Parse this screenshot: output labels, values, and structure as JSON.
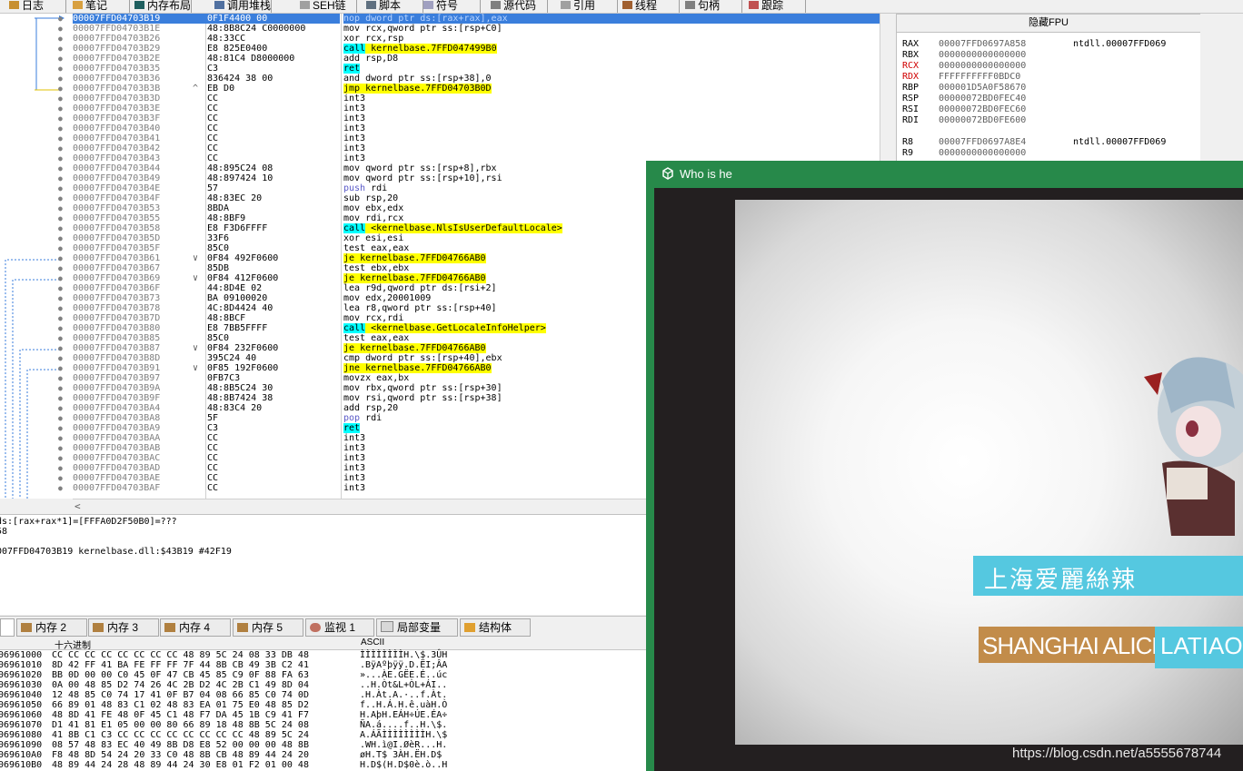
{
  "toolbar_tabs": [
    {
      "label": "日志",
      "icon": "log-icon"
    },
    {
      "label": "笔记",
      "icon": "notes-icon"
    },
    {
      "label": "内存布局",
      "icon": "memory-map-icon"
    },
    {
      "label": "调用堆栈",
      "icon": "call-stack-icon"
    },
    {
      "label": "SEH链",
      "icon": "seh-icon"
    },
    {
      "label": "脚本",
      "icon": "script-icon"
    },
    {
      "label": "符号",
      "icon": "symbols-icon"
    },
    {
      "label": "源代码",
      "icon": "source-icon"
    },
    {
      "label": "引用",
      "icon": "references-icon"
    },
    {
      "label": "线程",
      "icon": "threads-icon"
    },
    {
      "label": "句柄",
      "icon": "handles-icon"
    },
    {
      "label": "跟踪",
      "icon": "trace-icon"
    }
  ],
  "disasm": [
    {
      "addr": "00007FFD04703B19",
      "bytes": "0F1F4400 00",
      "ins": "nop dword ptr ds:[rax+rax],eax",
      "selected": true
    },
    {
      "addr": "00007FFD04703B1E",
      "bytes": "48:8B8C24 C0000000",
      "ins": "mov rcx,qword ptr ss:[rsp+C0]"
    },
    {
      "addr": "00007FFD04703B26",
      "bytes": "48:33CC",
      "ins": "xor rcx,rsp"
    },
    {
      "addr": "00007FFD04703B29",
      "bytes": "E8 825E0400",
      "ins": "call kernelbase.7FFD047499B0",
      "hl": "call"
    },
    {
      "addr": "00007FFD04703B2E",
      "bytes": "48:81C4 D8000000",
      "ins": "add rsp,D8"
    },
    {
      "addr": "00007FFD04703B35",
      "bytes": "C3",
      "ins": "ret",
      "hl": "ret"
    },
    {
      "addr": "00007FFD04703B36",
      "bytes": "836424 38 00",
      "ins": "and dword ptr ss:[rsp+38],0"
    },
    {
      "addr": "00007FFD04703B3B",
      "bytes": "EB D0",
      "ins": "jmp kernelbase.7FFD04703B0D",
      "hl": "jmp",
      "arrow": "^"
    },
    {
      "addr": "00007FFD04703B3D",
      "bytes": "CC",
      "ins": "int3"
    },
    {
      "addr": "00007FFD04703B3E",
      "bytes": "CC",
      "ins": "int3"
    },
    {
      "addr": "00007FFD04703B3F",
      "bytes": "CC",
      "ins": "int3"
    },
    {
      "addr": "00007FFD04703B40",
      "bytes": "CC",
      "ins": "int3"
    },
    {
      "addr": "00007FFD04703B41",
      "bytes": "CC",
      "ins": "int3"
    },
    {
      "addr": "00007FFD04703B42",
      "bytes": "CC",
      "ins": "int3"
    },
    {
      "addr": "00007FFD04703B43",
      "bytes": "CC",
      "ins": "int3"
    },
    {
      "addr": "00007FFD04703B44",
      "bytes": "48:895C24 08",
      "ins": "mov qword ptr ss:[rsp+8],rbx"
    },
    {
      "addr": "00007FFD04703B49",
      "bytes": "48:897424 10",
      "ins": "mov qword ptr ss:[rsp+10],rsi"
    },
    {
      "addr": "00007FFD04703B4E",
      "bytes": "57",
      "ins": "push rdi",
      "style": "blue"
    },
    {
      "addr": "00007FFD04703B4F",
      "bytes": "48:83EC 20",
      "ins": "sub rsp,20"
    },
    {
      "addr": "00007FFD04703B53",
      "bytes": "8BDA",
      "ins": "mov ebx,edx"
    },
    {
      "addr": "00007FFD04703B55",
      "bytes": "48:8BF9",
      "ins": "mov rdi,rcx"
    },
    {
      "addr": "00007FFD04703B58",
      "bytes": "E8 F3D6FFFF",
      "ins": "call <kernelbase.NlsIsUserDefaultLocale>",
      "hl": "call"
    },
    {
      "addr": "00007FFD04703B5D",
      "bytes": "33F6",
      "ins": "xor esi,esi"
    },
    {
      "addr": "00007FFD04703B5F",
      "bytes": "85C0",
      "ins": "test eax,eax"
    },
    {
      "addr": "00007FFD04703B61",
      "bytes": "0F84 492F0600",
      "ins": "je kernelbase.7FFD04766AB0",
      "hl": "jcc",
      "arrow": "v"
    },
    {
      "addr": "00007FFD04703B67",
      "bytes": "85DB",
      "ins": "test ebx,ebx"
    },
    {
      "addr": "00007FFD04703B69",
      "bytes": "0F84 412F0600",
      "ins": "je kernelbase.7FFD04766AB0",
      "hl": "jcc",
      "arrow": "v"
    },
    {
      "addr": "00007FFD04703B6F",
      "bytes": "44:8D4E 02",
      "ins": "lea r9d,qword ptr ds:[rsi+2]"
    },
    {
      "addr": "00007FFD04703B73",
      "bytes": "BA 09100020",
      "ins": "mov edx,20001009"
    },
    {
      "addr": "00007FFD04703B78",
      "bytes": "4C:8D4424 40",
      "ins": "lea r8,qword ptr ss:[rsp+40]"
    },
    {
      "addr": "00007FFD04703B7D",
      "bytes": "48:8BCF",
      "ins": "mov rcx,rdi"
    },
    {
      "addr": "00007FFD04703B80",
      "bytes": "E8 7BB5FFFF",
      "ins": "call <kernelbase.GetLocaleInfoHelper>",
      "hl": "call"
    },
    {
      "addr": "00007FFD04703B85",
      "bytes": "85C0",
      "ins": "test eax,eax"
    },
    {
      "addr": "00007FFD04703B87",
      "bytes": "0F84 232F0600",
      "ins": "je kernelbase.7FFD04766AB0",
      "hl": "jcc",
      "arrow": "v"
    },
    {
      "addr": "00007FFD04703B8D",
      "bytes": "395C24 40",
      "ins": "cmp dword ptr ss:[rsp+40],ebx"
    },
    {
      "addr": "00007FFD04703B91",
      "bytes": "0F85 192F0600",
      "ins": "jne kernelbase.7FFD04766AB0",
      "hl": "jcc",
      "arrow": "v"
    },
    {
      "addr": "00007FFD04703B97",
      "bytes": "0FB7C3",
      "ins": "movzx eax,bx"
    },
    {
      "addr": "00007FFD04703B9A",
      "bytes": "48:8B5C24 30",
      "ins": "mov rbx,qword ptr ss:[rsp+30]"
    },
    {
      "addr": "00007FFD04703B9F",
      "bytes": "48:8B7424 38",
      "ins": "mov rsi,qword ptr ss:[rsp+38]"
    },
    {
      "addr": "00007FFD04703BA4",
      "bytes": "48:83C4 20",
      "ins": "add rsp,20"
    },
    {
      "addr": "00007FFD04703BA8",
      "bytes": "5F",
      "ins": "pop rdi",
      "style": "blue"
    },
    {
      "addr": "00007FFD04703BA9",
      "bytes": "C3",
      "ins": "ret",
      "hl": "ret"
    },
    {
      "addr": "00007FFD04703BAA",
      "bytes": "CC",
      "ins": "int3"
    },
    {
      "addr": "00007FFD04703BAB",
      "bytes": "CC",
      "ins": "int3"
    },
    {
      "addr": "00007FFD04703BAC",
      "bytes": "CC",
      "ins": "int3"
    },
    {
      "addr": "00007FFD04703BAD",
      "bytes": "CC",
      "ins": "int3"
    },
    {
      "addr": "00007FFD04703BAE",
      "bytes": "CC",
      "ins": "int3"
    },
    {
      "addr": "00007FFD04703BAF",
      "bytes": "CC",
      "ins": "int3"
    }
  ],
  "info_lines": [
    "ds:[rax+rax*1]=[FFFA0D2F50B0]=???",
    "58",
    "",
    "007FFD04703B19 kernelbase.dll:$43B19 #42F19"
  ],
  "bottom_tabs": [
    "内存 2",
    "内存 3",
    "内存 4",
    "内存 5",
    "监视 1",
    "局部变量",
    "结构体"
  ],
  "hex": {
    "header_bytes": "十六进制",
    "header_ascii": "ASCII",
    "rows": [
      {
        "addr": "06961000",
        "bytes": "CC CC CC CC CC CC CC CC 48 89 5C 24 08 33 DB 48",
        "ascii": "ÌÌÌÌÌÌÌÌH.\\$.3ÛH"
      },
      {
        "addr": "06961010",
        "bytes": "8D 42 FF 41 BA FE FF FF 7F 44 8B CB 49 3B C2 41",
        "ascii": ".BÿAºþÿÿ.D.ËI;ÂA"
      },
      {
        "addr": "06961020",
        "bytes": "BB 0D 00 00 C0 45 0F 47 CB 45 85 C9 0F 88 FA 63",
        "ascii": "»...ÀE.GËE.É..úc"
      },
      {
        "addr": "06961030",
        "bytes": "0A 00 48 85 D2 74 26 4C 2B D2 4C 2B C1 49 8D 04",
        "ascii": "..H.Òt&L+ÒL+ÁI.."
      },
      {
        "addr": "06961040",
        "bytes": "12 48 85 C0 74 17 41 0F B7 04 08 66 85 C0 74 0D",
        "ascii": ".H.Àt.A.·..f.Àt."
      },
      {
        "addr": "06961050",
        "bytes": "66 89 01 48 83 C1 02 48 83 EA 01 75 E0 48 85 D2",
        "ascii": "f..H.Á.H.ê.uàH.Ò"
      },
      {
        "addr": "06961060",
        "bytes": "48 8D 41 FE 48 0F 45 C1 48 F7 DA 45 1B C9 41 F7",
        "ascii": "H.AþH.EÁH÷ÚE.ÉA÷"
      },
      {
        "addr": "06961070",
        "bytes": "D1 41 81 E1 05 00 00 80 66 89 18 48 8B 5C 24 08",
        "ascii": "ÑA.á....f..H.\\$."
      },
      {
        "addr": "06961080",
        "bytes": "41 8B C1 C3 CC CC CC CC CC CC CC CC 48 89 5C 24",
        "ascii": "A.ÁÃÌÌÌÌÌÌÌÌH.\\$"
      },
      {
        "addr": "06961090",
        "bytes": "08 57 48 83 EC 40 49 8B D8 E8 52 00 00 00 48 8B",
        "ascii": ".WH.ì@I.ØèR...H."
      },
      {
        "addr": "069610A0",
        "bytes": "F8 48 8D 54 24 20 33 C0 48 8B CB 48 89 44 24 20",
        "ascii": "øH.T$ 3ÀH.ËH.D$ "
      },
      {
        "addr": "069610B0",
        "bytes": "48 89 44 24 28 48 89 44 24 30 E8 01 F2 01 00 48",
        "ascii": "H.D$(H.D$0è.ò..H"
      }
    ]
  },
  "fpu": {
    "title": "隐藏FPU",
    "registers": [
      {
        "name": "RAX",
        "value": "00007FFD0697A858",
        "comment": "ntdll.00007FFD069"
      },
      {
        "name": "RBX",
        "value": "0000000000000000",
        "comment": ""
      },
      {
        "name": "RCX",
        "value": "0000000000000000",
        "comment": "",
        "changed": true
      },
      {
        "name": "RDX",
        "value": "FFFFFFFFFF0BDC0",
        "comment": "",
        "changed": true
      },
      {
        "name": "RBP",
        "value": "000001D5A0F58670",
        "comment": ""
      },
      {
        "name": "RSP",
        "value": "00000072BD0FEC40",
        "comment": ""
      },
      {
        "name": "RSI",
        "value": "00000072BD0FEC60",
        "comment": ""
      },
      {
        "name": "RDI",
        "value": "00000072BD0FE600",
        "comment": ""
      },
      {
        "name": "",
        "value": "",
        "comment": ""
      },
      {
        "name": "R8",
        "value": "00007FFD0697A8E4",
        "comment": "ntdll.00007FFD069"
      },
      {
        "name": "R9",
        "value": "0000000000000000",
        "comment": ""
      }
    ]
  },
  "game_window": {
    "title": "Who is he",
    "banner_cn": "上海爱麗絲辣",
    "banner_en1": "SHANGHAI ALICE",
    "banner_en2": "LATIAO F"
  },
  "watermark": "https://blog.csdn.net/a5555678744"
}
